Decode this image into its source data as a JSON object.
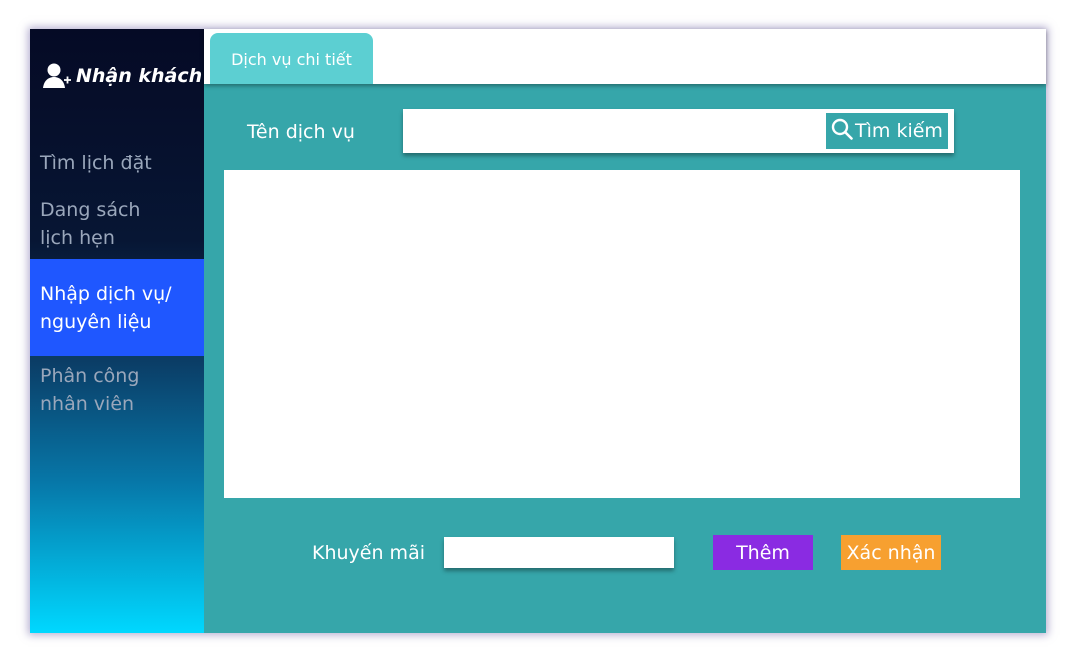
{
  "sidebar": {
    "brand": {
      "title": "Nhận khách",
      "icon": "add-user-icon"
    },
    "items": [
      {
        "lines": [
          "Tìm lịch đặt"
        ],
        "active": false
      },
      {
        "lines": [
          "Dang sách",
          "lịch hẹn"
        ],
        "active": false
      },
      {
        "lines": [
          "Nhập dịch vụ/",
          "nguyên liệu"
        ],
        "active": true
      },
      {
        "lines": [
          "Phân công",
          "nhân viên"
        ],
        "active": false
      }
    ]
  },
  "tabs": [
    {
      "label": "Dịch vụ chi tiết",
      "active": true
    }
  ],
  "search": {
    "label": "Tên dịch vụ",
    "value": "",
    "placeholder": "",
    "button_label": "Tìm kiếm",
    "button_icon": "search-icon"
  },
  "footer": {
    "promo_label": "Khuyến mãi",
    "promo_value": "",
    "add_label": "Thêm",
    "confirm_label": "Xác nhận"
  },
  "colors": {
    "content_bg": "#36a6aa",
    "active_nav": "#1f57ff",
    "tab_bg": "#5ccfd2",
    "add_button": "#8a2be2",
    "confirm_button": "#f7a030"
  }
}
